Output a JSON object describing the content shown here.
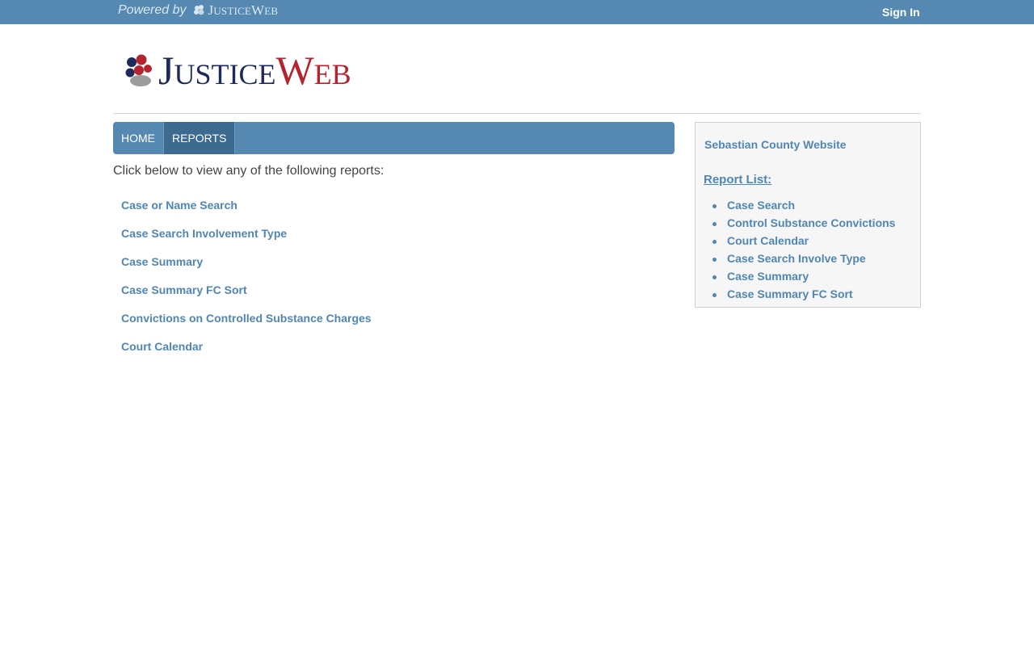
{
  "header": {
    "powered_by": "Powered by",
    "mini_brand_initial_1": "J",
    "mini_brand_rest_1": "USTICE",
    "mini_brand_initial_2": "W",
    "mini_brand_rest_2": "EB",
    "sign_in": "Sign In"
  },
  "logo": {
    "initial_1": "J",
    "rest_1": "USTICE",
    "initial_2": "W",
    "rest_2": "EB"
  },
  "nav": {
    "items": [
      {
        "label": "HOME"
      },
      {
        "label": "REPORTS"
      }
    ]
  },
  "main": {
    "intro": "Click below to view any of the following reports:",
    "reports": [
      {
        "label": "Case or Name Search"
      },
      {
        "label": "Case Search Involvement Type"
      },
      {
        "label": "Case Summary"
      },
      {
        "label": "Case Summary FC Sort"
      },
      {
        "label": "Convictions on Controlled Substance Charges"
      },
      {
        "label": "Court Calendar"
      }
    ]
  },
  "sidebar": {
    "county_link": "Sebastian County Website",
    "list_heading": "Report List:",
    "items": [
      {
        "label": "Case Search"
      },
      {
        "label": "Control Substance Convictions"
      },
      {
        "label": "Court Calendar"
      },
      {
        "label": "Case Search Involve Type"
      },
      {
        "label": "Case Summary"
      },
      {
        "label": "Case Summary FC Sort"
      }
    ]
  },
  "colors": {
    "topbar": "#5589b2",
    "nav_active": "#3d6a8f",
    "link": "#4f86b3",
    "brand_navy": "#1f2a5b",
    "brand_red": "#b5242e"
  }
}
